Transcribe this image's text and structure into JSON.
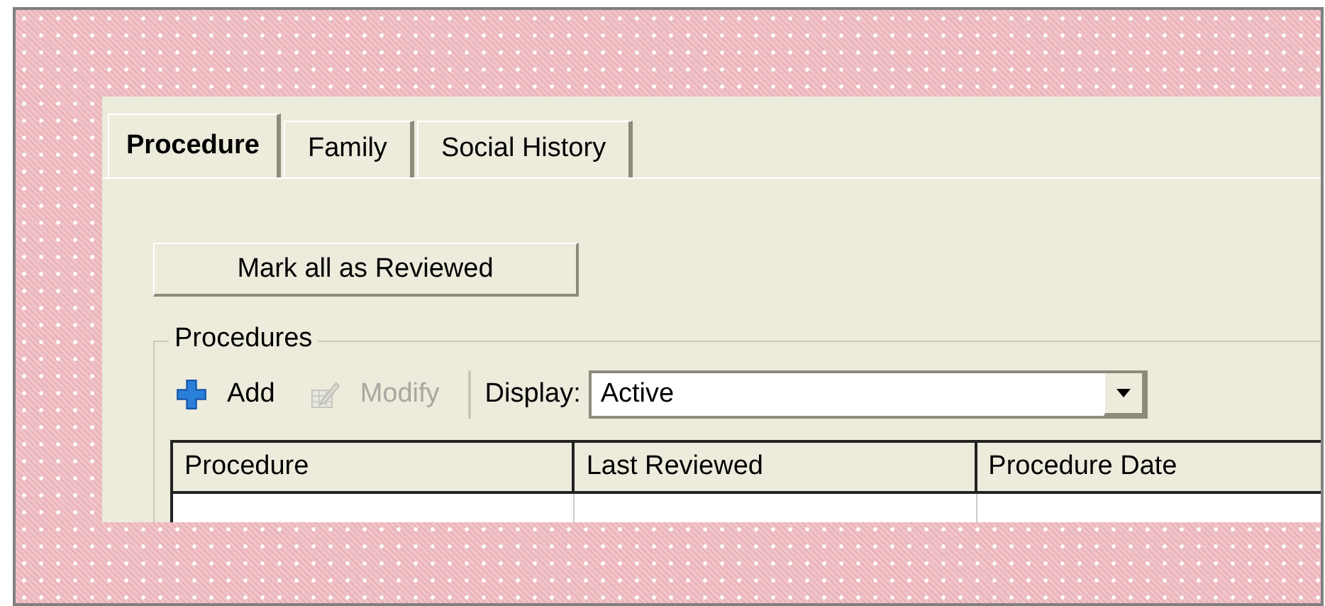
{
  "tabs": [
    {
      "label": "Procedure",
      "selected": true
    },
    {
      "label": "Family",
      "selected": false
    },
    {
      "label": "Social History",
      "selected": false
    }
  ],
  "review_button": "Mark all as Reviewed",
  "group": {
    "title": "Procedures",
    "toolbar": [
      {
        "kind": "add",
        "label": "Add",
        "disabled": false
      },
      {
        "kind": "modify",
        "label": "Modify",
        "disabled": true
      }
    ],
    "display": {
      "label": "Display:",
      "value": "Active"
    },
    "table": {
      "columns": [
        "Procedure",
        "Last Reviewed",
        "Procedure Date"
      ]
    }
  }
}
